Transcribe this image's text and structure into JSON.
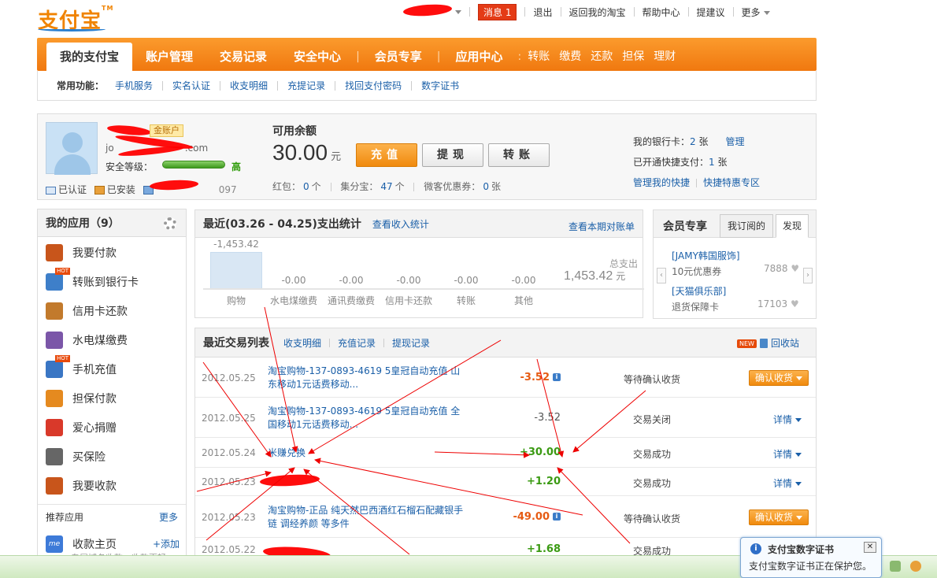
{
  "brand": {
    "logo_text": "支付宝",
    "tm": "TM"
  },
  "topbar": {
    "messages_label": "消息",
    "messages_count": "1",
    "logout": "退出",
    "back_taobao": "返回我的淘宝",
    "help": "帮助中心",
    "suggest": "提建议",
    "more": "更多"
  },
  "nav": {
    "tabs": [
      "我的支付宝",
      "账户管理",
      "交易记录",
      "安全中心",
      "会员专享",
      "应用中心"
    ],
    "quick": [
      "转账",
      "缴费",
      "还款",
      "担保",
      "理财"
    ]
  },
  "subnav": {
    "label": "常用功能：",
    "links": [
      "手机服务",
      "实名认证",
      "收支明细",
      "充提记录",
      "找回支付密码",
      "数字证书"
    ]
  },
  "account": {
    "gold_badge": "金账户",
    "email_visible": "jo",
    "email_suffix": ".com",
    "security_label": "安全等级：",
    "security_level": "高",
    "security_fraction": 1.0,
    "verified": "已认证",
    "installed": "已安装",
    "id_tail": "097",
    "balance_label": "可用余额",
    "balance": "30.00",
    "balance_unit": "元",
    "btn_recharge": "充值",
    "btn_withdraw": "提现",
    "btn_transfer": "转账",
    "redpack_label": "红包：",
    "redpack_val": "0",
    "redpack_unit": "个",
    "jifen_label": "集分宝：",
    "jifen_val": "47",
    "jifen_unit": "个",
    "coupon_label": "微客优惠券：",
    "coupon_val": "0",
    "coupon_unit": "张",
    "bank_label": "我的银行卡：",
    "bank_count": "2",
    "bank_unit": "张",
    "bank_manage": "管理",
    "quickpay_label": "已开通快捷支付：",
    "quickpay_count": "1",
    "quickpay_unit": "张",
    "manage_quick": "管理我的快捷",
    "quick_zone": "快捷特惠专区"
  },
  "apps": {
    "title": "我的应用（9）",
    "items": [
      {
        "label": "我要付款",
        "color": "#c8551b",
        "hot": false
      },
      {
        "label": "转账到银行卡",
        "color": "#3e7fc9",
        "hot": true
      },
      {
        "label": "信用卡还款",
        "color": "#c27a2c",
        "hot": false
      },
      {
        "label": "水电煤缴费",
        "color": "#7b56a8",
        "hot": false
      },
      {
        "label": "手机充值",
        "color": "#3a76c4",
        "hot": true
      },
      {
        "label": "担保付款",
        "color": "#e58a1f",
        "hot": false
      },
      {
        "label": "爱心捐赠",
        "color": "#d9392a",
        "hot": false
      },
      {
        "label": "买保险",
        "color": "#666666",
        "hot": false
      },
      {
        "label": "我要收款",
        "color": "#c8551b",
        "hot": false
      }
    ],
    "hot_text": "HOT",
    "recommend_title": "推荐应用",
    "recommend_more": "更多",
    "rec_item": "收款主页",
    "rec_icon_text": "me",
    "rec_add": "+添加",
    "rec_desc": "专属域名收款，收款更轻"
  },
  "stats": {
    "title": "最近(03.26 - 04.25)支出统计",
    "income_link": "查看收入统计",
    "bill_link": "查看本期对账单",
    "total_label": "总支出",
    "total_value": "1,453.42",
    "total_unit": "元"
  },
  "chart_data": {
    "type": "bar",
    "categories": [
      "购物",
      "水电煤缴费",
      "通讯费缴费",
      "信用卡还款",
      "转账",
      "其他"
    ],
    "values": [
      -1453.42,
      0,
      0,
      0,
      0,
      0
    ],
    "value_labels": [
      "-1,453.42",
      "-0.00",
      "-0.00",
      "-0.00",
      "-0.00",
      "-0.00"
    ]
  },
  "member": {
    "title": "会员专享",
    "tab_sub": "我订阅的",
    "tab_discover": "发现",
    "items": [
      {
        "name": "[JAMY韩国服饰]",
        "desc": "10元优惠券",
        "count": "7888"
      },
      {
        "name": "[天猫俱乐部]",
        "desc": "退货保障卡",
        "count": "17103"
      }
    ],
    "left_arrow": "‹",
    "right_arrow": "›",
    "heart": "♥"
  },
  "tx": {
    "title": "最近交易列表",
    "links": [
      "收支明细",
      "充值记录",
      "提现记录"
    ],
    "new_badge": "NEW",
    "recycle": "回收站",
    "confirm_label": "确认收货",
    "detail_label": "详情",
    "rows": [
      {
        "date": "2012.05.25",
        "desc": "淘宝购物-137-0893-4619 5皇冠自动充值 山东移动1元话费移动...",
        "amount": "-3.52",
        "kind": "neg",
        "status": "等待确认收货",
        "action": "confirm",
        "info": true
      },
      {
        "date": "2012.05.25",
        "desc": "淘宝购物-137-0893-4619 5皇冠自动充值 全国移动1元话费移动...",
        "amount": "-3.52",
        "kind": "negg",
        "status": "交易关闭",
        "action": "detail",
        "info": false
      },
      {
        "date": "2012.05.24",
        "desc": "米赚兑换",
        "amount": "+30.00",
        "kind": "pos",
        "status": "交易成功",
        "action": "detail",
        "info": false
      },
      {
        "date": "2012.05.23",
        "desc": "",
        "amount": "+1.20",
        "kind": "pos",
        "status": "交易成功",
        "action": "detail",
        "info": false
      },
      {
        "date": "2012.05.23",
        "desc": "淘宝购物-正品 纯天然巴西酒红石榴石配藏银手链 调经养颜 等多件",
        "amount": "-49.00",
        "kind": "neg",
        "status": "等待确认收货",
        "action": "confirm",
        "info": true
      },
      {
        "date": "2012.05.22",
        "desc": "",
        "amount": "+1.68",
        "kind": "pos",
        "status": "交易成功",
        "action": "none",
        "info": false
      }
    ]
  },
  "notification": {
    "title": "支付宝数字证书",
    "body": "支付宝数字证书正在保护您。",
    "close": "✕",
    "info": "i"
  }
}
